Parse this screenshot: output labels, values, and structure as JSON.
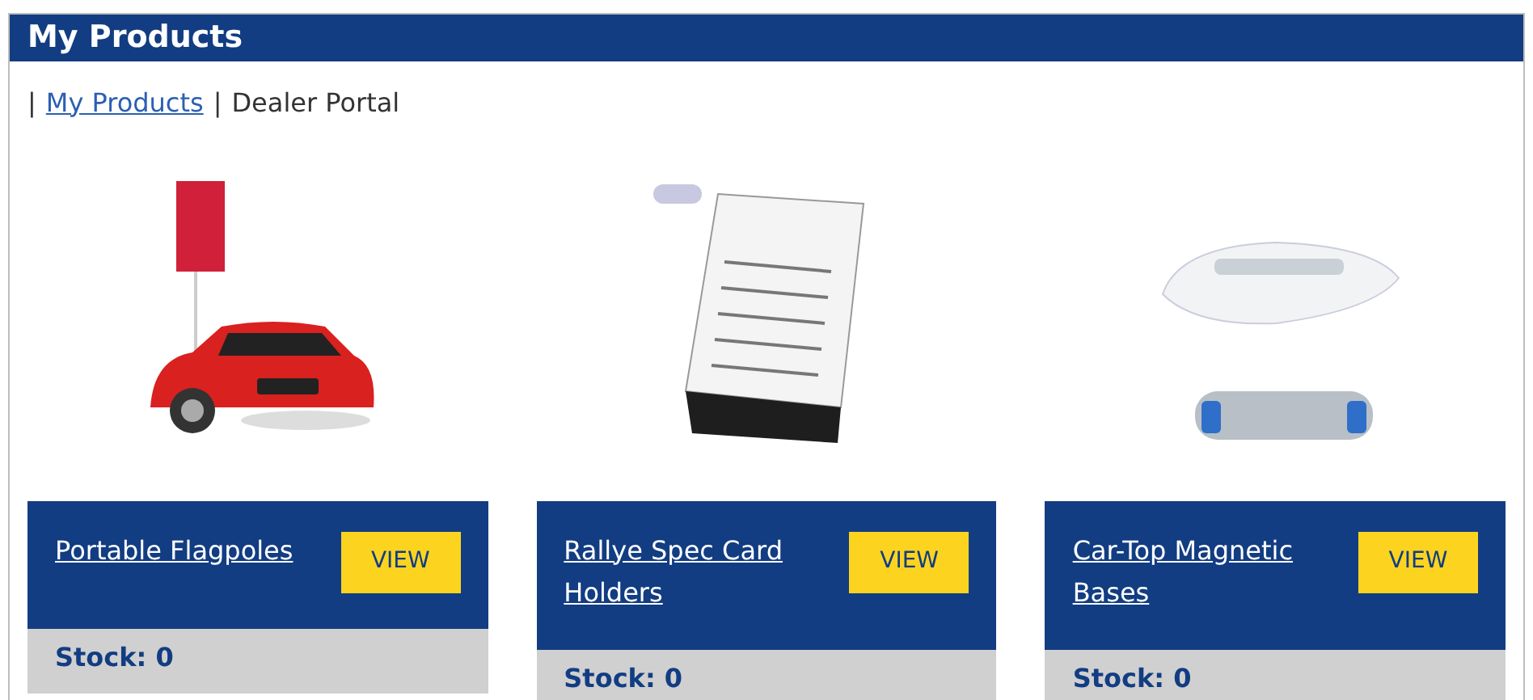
{
  "header": {
    "title": "My Products"
  },
  "breadcrumb": {
    "separator_1": "|",
    "link": "My Products",
    "separator_2": "|",
    "current": "Dealer Portal"
  },
  "products": [
    {
      "kind": "flagpole",
      "name": "Portable Flagpoles",
      "button": "VIEW",
      "stock": "Stock: 0"
    },
    {
      "kind": "card_holder",
      "name": "Rallye Spec Card Holders",
      "button": "VIEW",
      "stock": "Stock: 0"
    },
    {
      "kind": "magnetic_base",
      "name": "Car-Top Magnetic Bases",
      "button": "VIEW",
      "stock": "Stock: 0"
    }
  ]
}
